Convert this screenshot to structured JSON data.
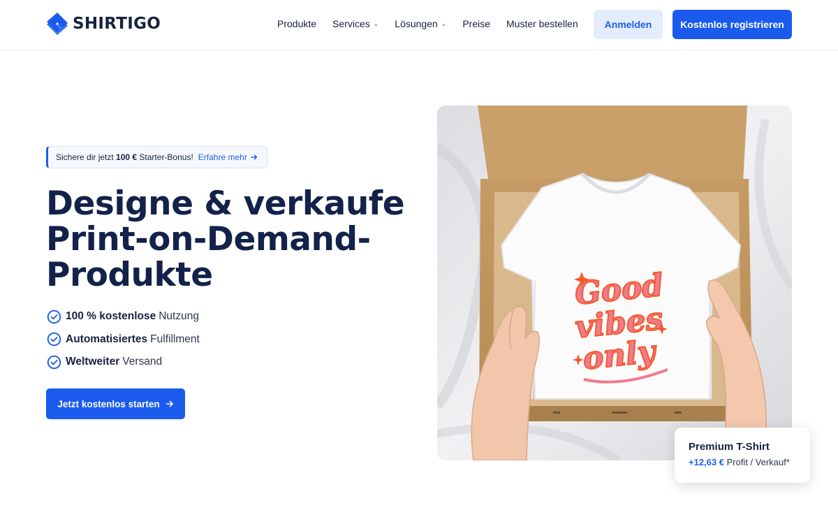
{
  "brand": {
    "name": "SHIRTIGO"
  },
  "nav": [
    {
      "label": "Produkte",
      "dropdown": false
    },
    {
      "label": "Services",
      "dropdown": true
    },
    {
      "label": "Lösungen",
      "dropdown": true
    },
    {
      "label": "Preise",
      "dropdown": false
    },
    {
      "label": "Muster bestellen",
      "dropdown": false
    }
  ],
  "header": {
    "login_label": "Anmelden",
    "register_label": "Kostenlos registrieren"
  },
  "promo": {
    "prefix": "Sichere dir jetzt",
    "amount": "100 €",
    "suffix": "Starter-Bonus!",
    "link": "Erfahre mehr"
  },
  "hero": {
    "headline_lines": [
      "Designe & verkaufe",
      "Print-on-Demand-",
      "Produkte"
    ],
    "features": [
      {
        "bold": "100 % kostenlose",
        "rest": "Nutzung"
      },
      {
        "bold": "Automatisiertes",
        "rest": "Fulfillment"
      },
      {
        "bold": "Weltweiter",
        "rest": "Versand"
      }
    ],
    "cta_label": "Jetzt kostenlos starten"
  },
  "product_image": {
    "print_lines": [
      "Good",
      "vibes",
      "only"
    ]
  },
  "price_card": {
    "title": "Premium T-Shirt",
    "profit": "+12,63 €",
    "suffix": "Profit / Verkauf*"
  },
  "colors": {
    "accent": "#1a5bee",
    "navy": "#13224a",
    "light_accent": "#e3edfd"
  },
  "icons": {
    "check": "check-circle-icon",
    "arrow": "arrow-right-icon",
    "chevron": "chevron-down-icon"
  }
}
